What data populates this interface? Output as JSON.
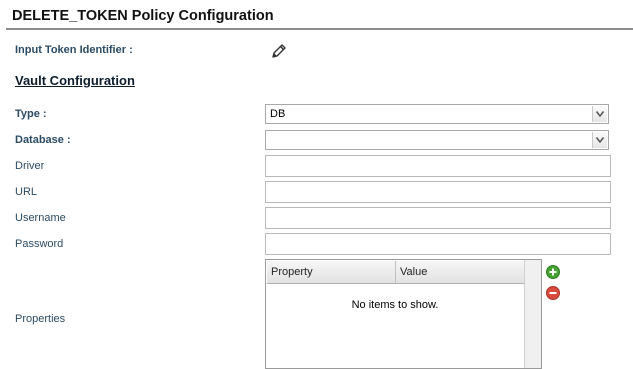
{
  "header": {
    "title": "DELETE_TOKEN Policy Configuration"
  },
  "fields": {
    "input_token_label": "Input Token Identifier :",
    "input_token_icon": "pencil-icon"
  },
  "vault": {
    "section_title": "Vault Configuration",
    "type_label": "Type :",
    "type_value": "DB",
    "database_label": "Database :",
    "database_value": "",
    "driver_label": "Driver",
    "driver_value": "",
    "url_label": "URL",
    "url_value": "",
    "username_label": "Username",
    "username_value": "",
    "password_label": "Password",
    "password_value": "",
    "properties_label": "Properties",
    "properties_grid": {
      "columns": [
        "Property",
        "Value"
      ],
      "empty_text": "No items to show."
    },
    "add_icon": "plus-circle-icon",
    "remove_icon": "minus-circle-icon"
  },
  "colors": {
    "add": "#44a332",
    "remove": "#d94a3c",
    "label": "#2b4b64"
  }
}
